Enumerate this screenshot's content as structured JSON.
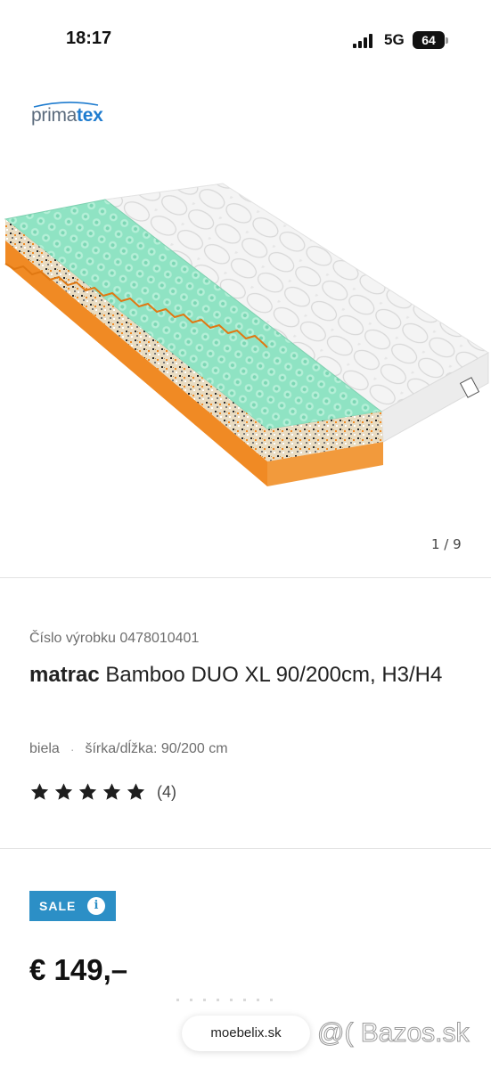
{
  "status_bar": {
    "time": "18:17",
    "network": "5G",
    "battery": "64"
  },
  "brand": {
    "logo_part1": "prima",
    "logo_part2": "tex"
  },
  "gallery": {
    "counter": "1 / 9"
  },
  "product": {
    "number_label": "Číslo výrobku 0478010401",
    "title_bold": "matrac",
    "title_rest": " Bamboo DUO XL 90/200cm, H3/H4",
    "color": "biela",
    "separator": "·",
    "dimensions": "šírka/dĺžka: 90/200 cm",
    "rating_stars": 5,
    "rating_count": "(4)"
  },
  "pricing": {
    "badge": "SALE",
    "info_icon": "i",
    "price": "€ 149,–"
  },
  "browser": {
    "url": "moebelix.sk"
  },
  "watermark": "@( Bazos.sk",
  "colors": {
    "accent_blue": "#2c8fc6",
    "logo_blue": "#1f7ccf",
    "foam_green": "#8fe3c3",
    "foam_orange": "#f08a24"
  },
  "icons": [
    "signal-icon",
    "battery-icon",
    "info-icon",
    "star-icon"
  ]
}
